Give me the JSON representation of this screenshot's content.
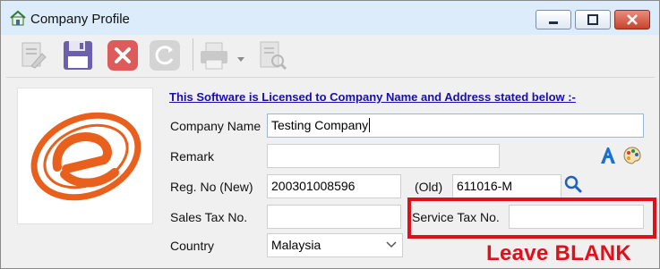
{
  "window": {
    "title": "Company Profile",
    "icon": "company-profile-icon"
  },
  "toolbar": {
    "buttons": [
      {
        "icon": "edit-document-icon",
        "name": "edit"
      },
      {
        "icon": "save-icon",
        "name": "save"
      },
      {
        "icon": "cancel-icon",
        "name": "cancel"
      },
      {
        "icon": "refresh-icon",
        "name": "refresh"
      },
      {
        "icon": "print-icon",
        "name": "print"
      },
      {
        "icon": "print-preview-icon",
        "name": "preview"
      }
    ]
  },
  "form": {
    "license_text": "This Software is Licensed to Company Name and Address stated below :-",
    "company_name_label": "Company Name",
    "company_name_value": "Testing Company",
    "remark_label": "Remark",
    "remark_value": "",
    "reg_no_new_label": "Reg. No (New)",
    "reg_no_new_value": "200301008596",
    "reg_no_old_label": "(Old)",
    "reg_no_old_value": "611016-M",
    "sales_tax_label": "Sales Tax No.",
    "sales_tax_value": "",
    "service_tax_label": "Service Tax No.",
    "service_tax_value": "",
    "country_label": "Country",
    "country_value": "Malaysia"
  },
  "annotation": {
    "text": "Leave BLANK",
    "color": "#e0101a"
  },
  "colors": {
    "brand_orange": "#e8601c",
    "link_blue": "#1a0dab"
  }
}
